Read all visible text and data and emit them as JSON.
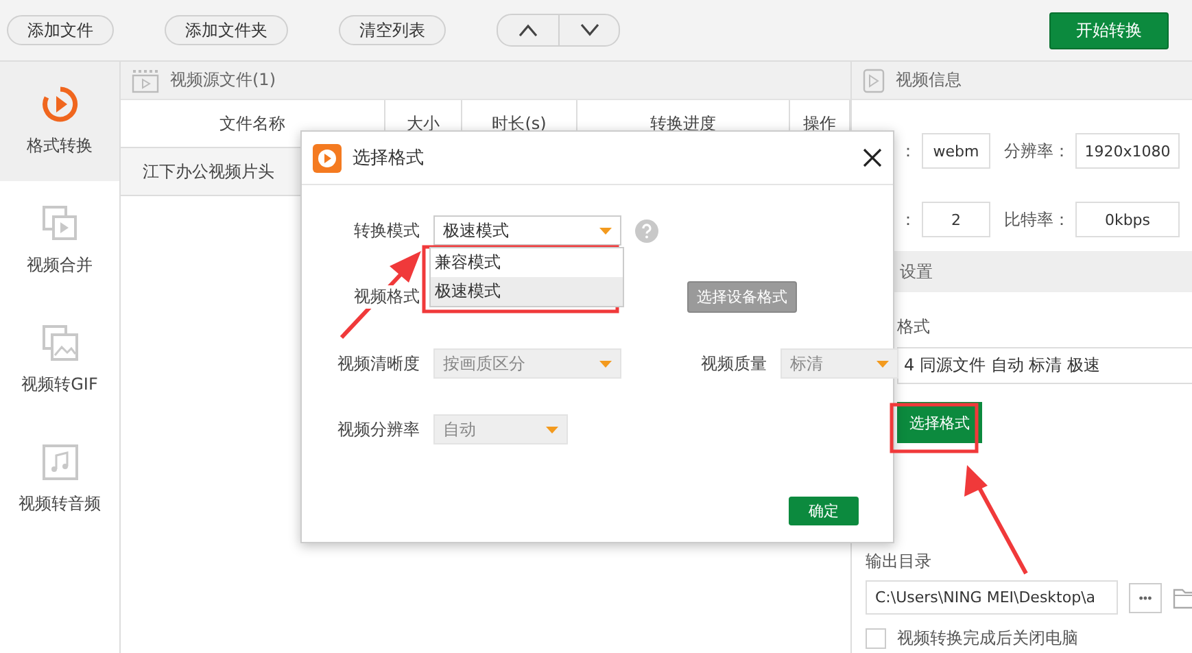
{
  "toolbar": {
    "buttons": [
      {
        "label": "添加文件"
      },
      {
        "label": "添加文件夹"
      },
      {
        "label": "清空列表"
      }
    ],
    "start_button": "开始转换"
  },
  "sidebar": {
    "items": [
      {
        "label": "格式转换",
        "kind": "convert",
        "selected": true
      },
      {
        "label": "视频合并",
        "kind": "merge",
        "selected": false
      },
      {
        "label": "视频转GIF",
        "kind": "gif",
        "selected": false
      },
      {
        "label": "视频转音频",
        "kind": "audio",
        "selected": false
      }
    ]
  },
  "source_panel": {
    "title": "视频源文件(1)",
    "columns": [
      "文件名称",
      "大小",
      "时长(s)",
      "转换进度",
      "操作"
    ],
    "rows": [
      {
        "name": "江下办公视频片头"
      }
    ]
  },
  "info_panel": {
    "title": "视频信息",
    "rows": [
      [
        {
          "label": "：",
          "value": "webm"
        },
        {
          "label": "分辨率：",
          "value": "1920x1080"
        }
      ],
      [
        {
          "label": "：",
          "value": "2"
        },
        {
          "label": "比特率：",
          "value": "0kbps"
        }
      ]
    ]
  },
  "settings": {
    "title": "设置",
    "format_label": "格式",
    "format_value": "4 同源文件 自动 标清 极速",
    "choose_button": "选择格式",
    "output_label": "输出目录",
    "output_path": "C:\\Users\\NING MEI\\Desktop\\a",
    "browse_button": "•••",
    "shutdown": {
      "label": "视频转换完成后关闭电脑",
      "checked": false
    }
  },
  "dialog": {
    "title": "选择格式",
    "mode": {
      "label": "转换模式",
      "value": "极速模式",
      "options": [
        {
          "label": "兼容模式",
          "selected": false
        },
        {
          "label": "极速模式",
          "selected": true
        }
      ]
    },
    "format": {
      "label": "视频格式",
      "button": "选择设备格式"
    },
    "clarity": {
      "label": "视频清晰度",
      "value": "按画质区分",
      "disabled": true
    },
    "quality": {
      "label": "视频质量",
      "value": "标清",
      "disabled": true
    },
    "resolution": {
      "label": "视频分辨率",
      "value": "自动",
      "disabled": true
    },
    "confirm": "确定"
  }
}
